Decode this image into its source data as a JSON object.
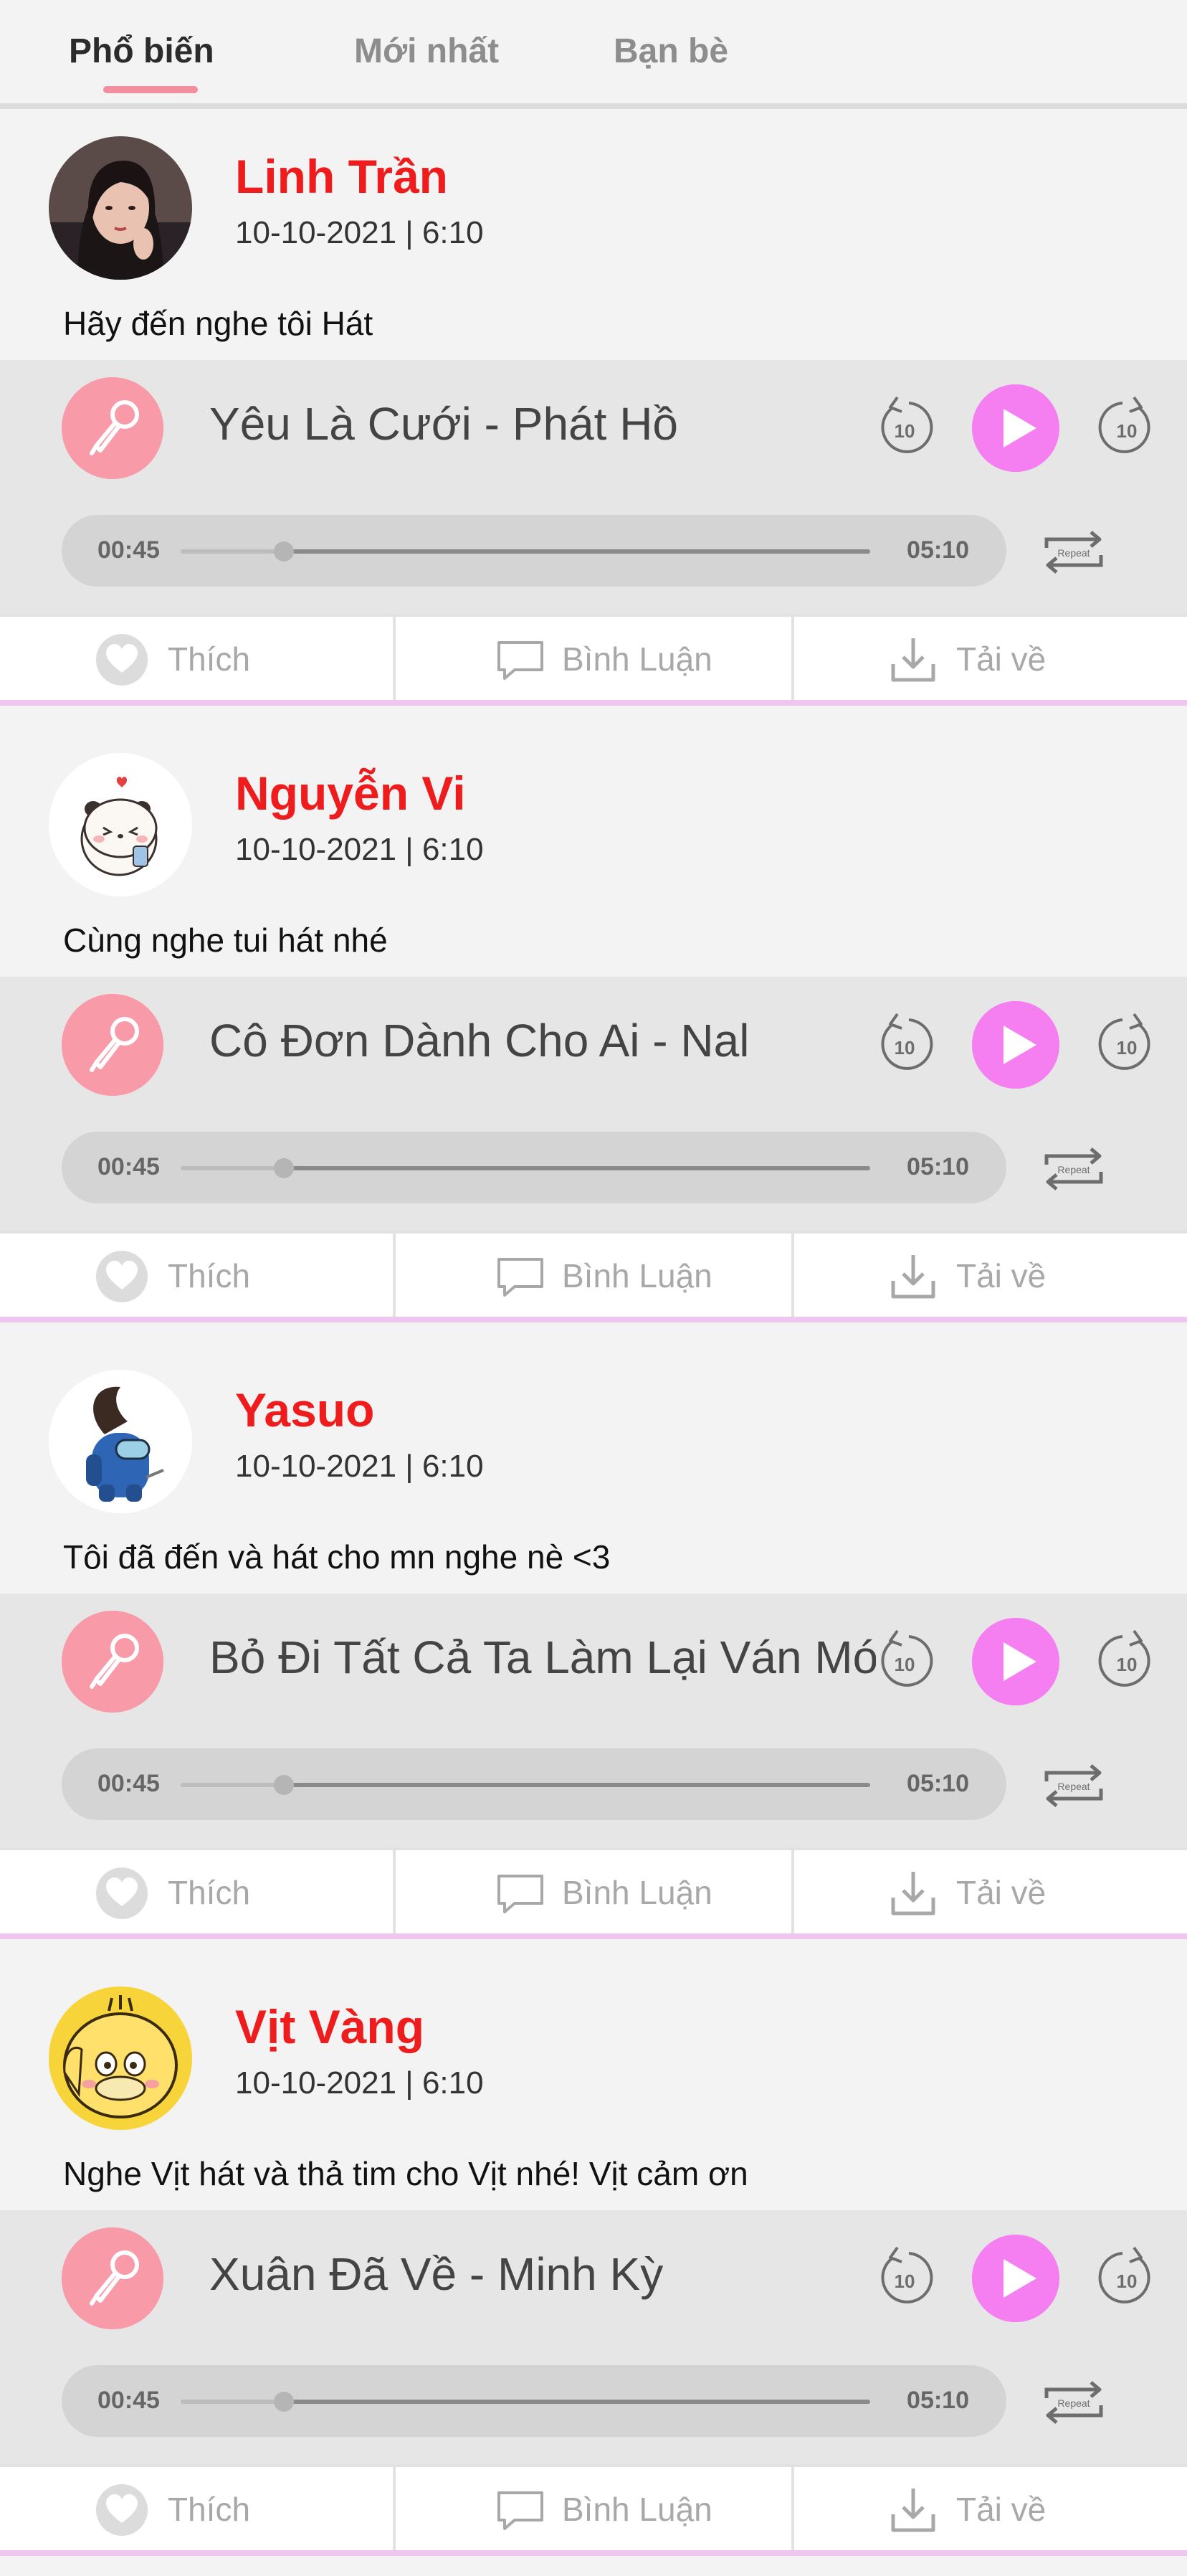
{
  "tabs": [
    {
      "label": "Phổ biến",
      "active": true
    },
    {
      "label": "Mới nhất",
      "active": false
    },
    {
      "label": "Bạn bè",
      "active": false
    }
  ],
  "posts": [
    {
      "username": "Linh Trần",
      "datetime": "10-10-2021  |  6:10",
      "caption": "Hãy đến nghe tôi Hát",
      "song": "Yêu Là Cưới - Phát Hồ",
      "time_current": "00:45",
      "time_total": "05:10",
      "avatar": "girl-photo"
    },
    {
      "username": "Nguyễn Vi",
      "datetime": "10-10-2021  |  6:10",
      "caption": "Cùng nghe tui hát nhé",
      "song": "Cô Đơn Dành Cho Ai - Nal",
      "time_current": "00:45",
      "time_total": "05:10",
      "avatar": "panda-sticker"
    },
    {
      "username": "Yasuo",
      "datetime": "10-10-2021  |  6:10",
      "caption": "Tôi đã đến và hát cho mn nghe nè <3",
      "song": "Bỏ Đi Tất Cả Ta Làm Lại Ván Mới",
      "time_current": "00:45",
      "time_total": "05:10",
      "avatar": "among-us-sticker"
    },
    {
      "username": "Vịt Vàng",
      "datetime": "10-10-2021  |  6:10",
      "caption": "Nghe Vịt hát và thả tim cho Vịt nhé! Vịt cảm ơn",
      "song": "Xuân Đã Về - Minh Kỳ",
      "time_current": "00:45",
      "time_total": "05:10",
      "avatar": "psyduck-sticker"
    }
  ],
  "player": {
    "skip_seconds": "10",
    "repeat_label": "Repeat",
    "progress_fraction": 0.15
  },
  "actions": {
    "like": "Thích",
    "comment": "Bình Luận",
    "download": "Tải về"
  },
  "colors": {
    "username": "#ee1c1c",
    "play": "#f57ef0",
    "mic": "#f89aa8",
    "tab_indicator": "#f38ea0",
    "post_divider": "#efc6ef"
  }
}
